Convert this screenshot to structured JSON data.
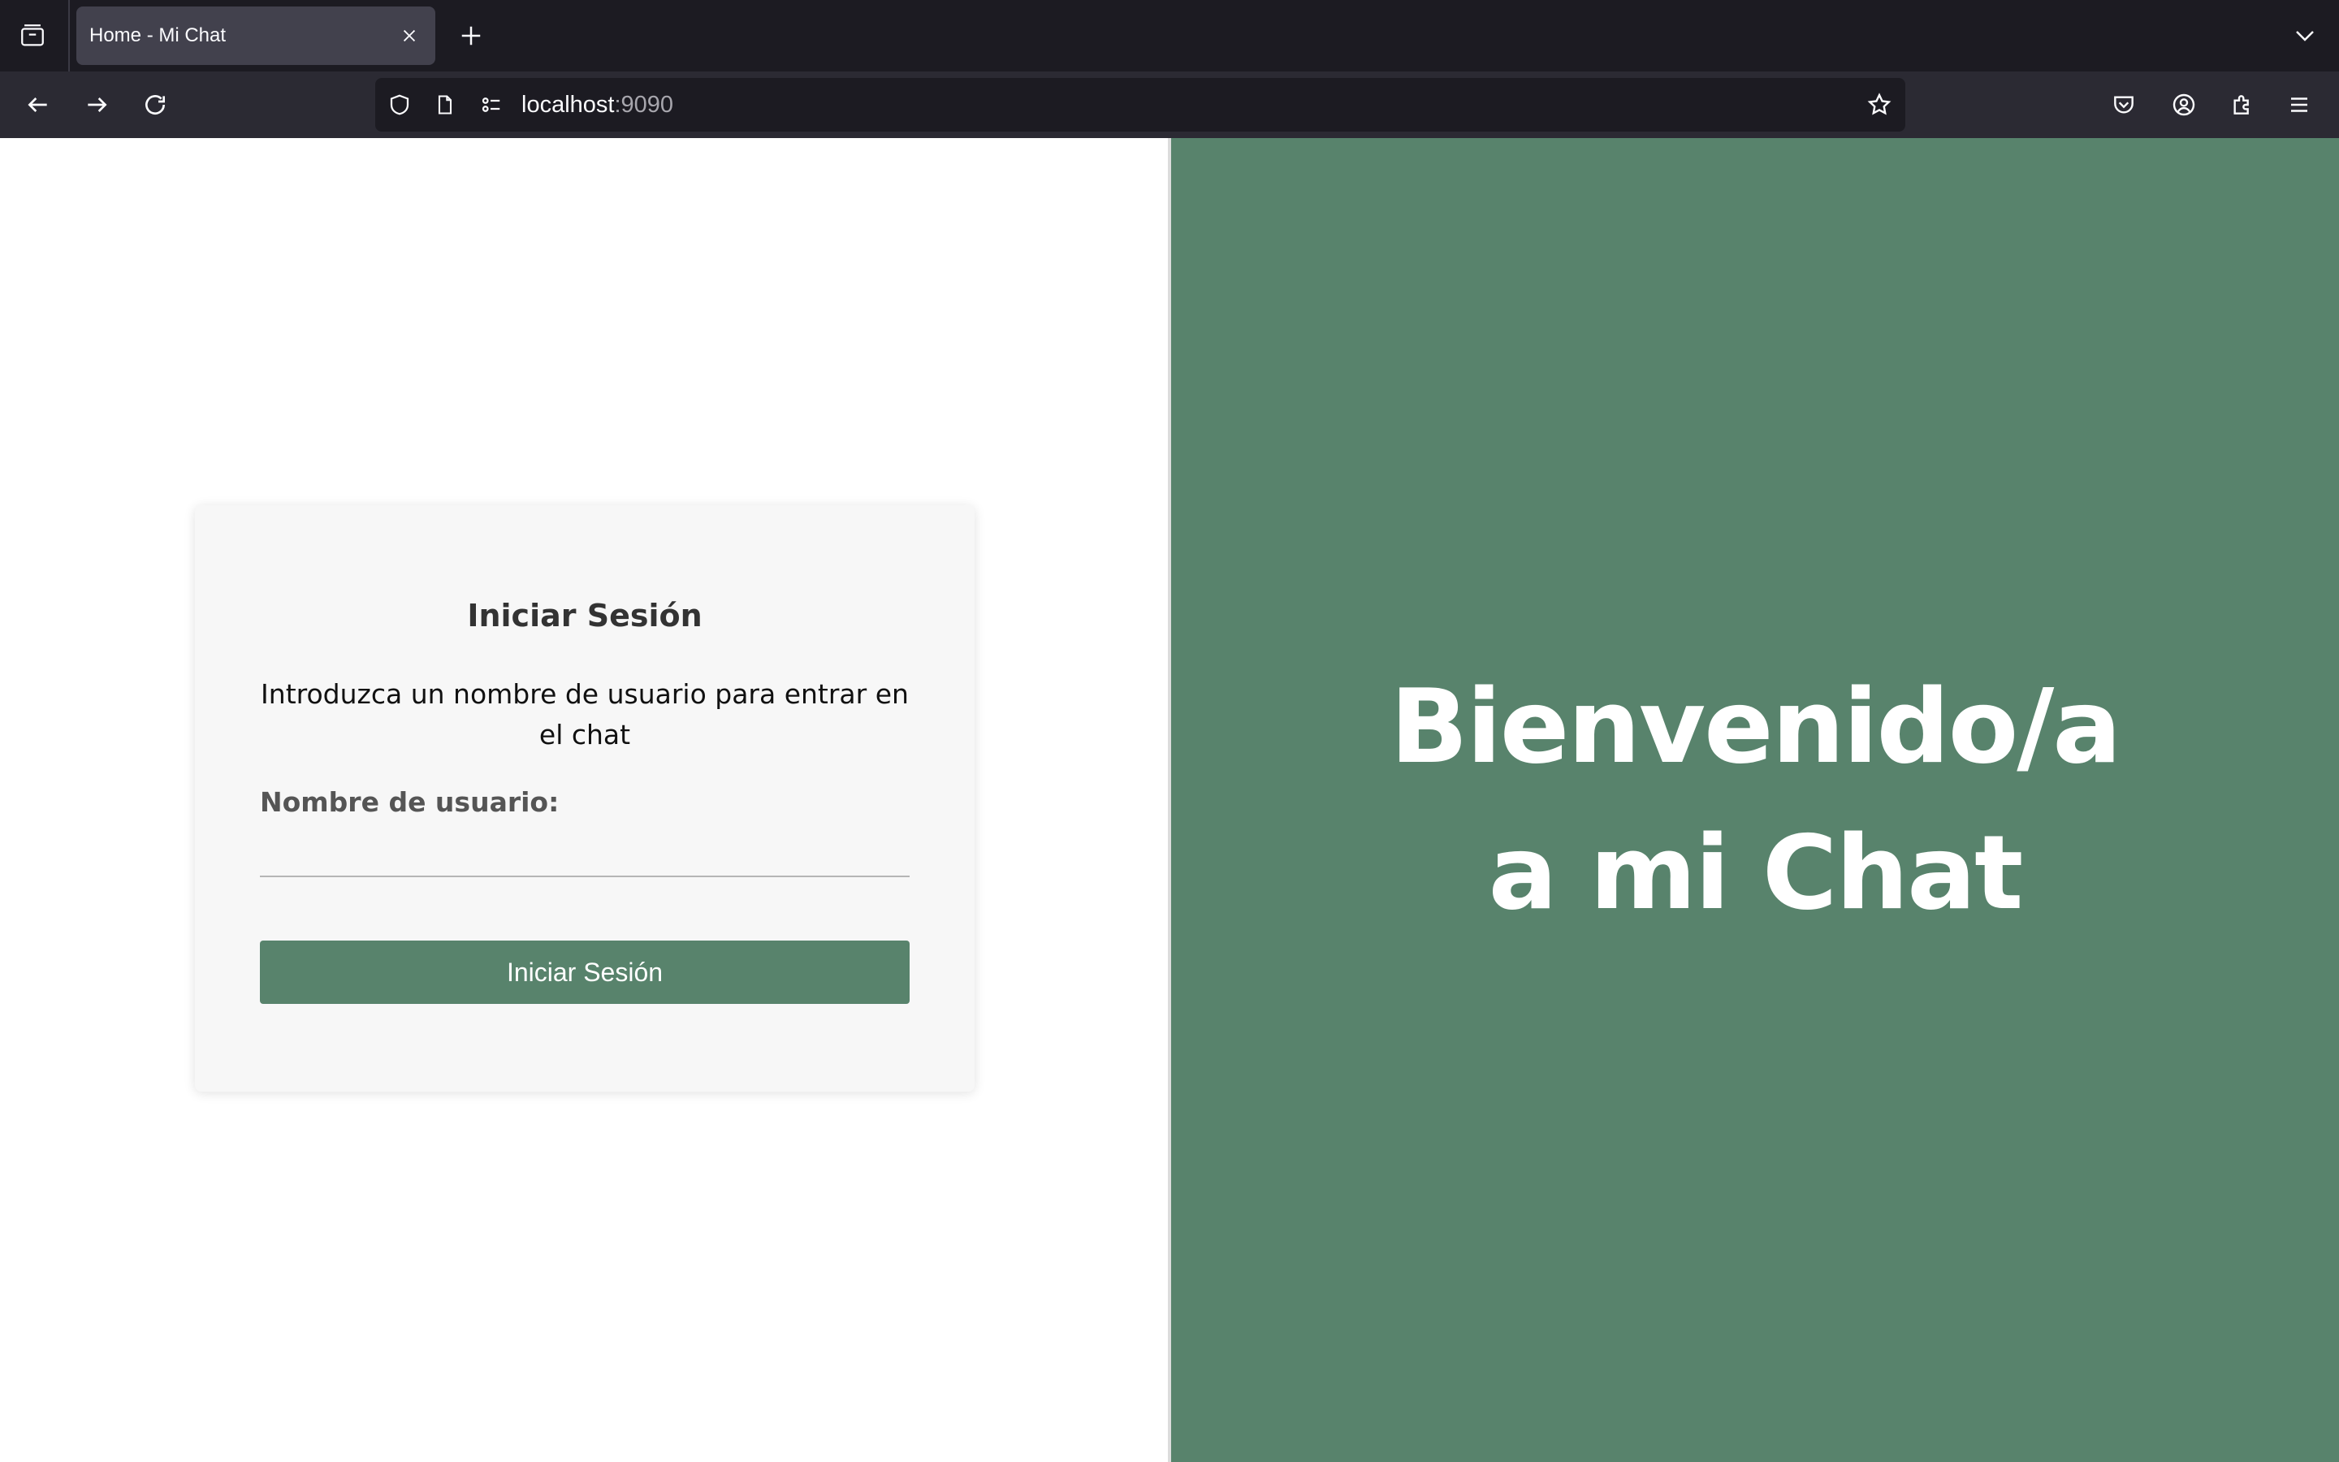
{
  "browser": {
    "tab": {
      "title": "Home - Mi Chat"
    },
    "url": {
      "host": "localhost",
      "port": ":9090"
    },
    "icons": {
      "tab_list": "tab-list-icon",
      "close": "close-icon",
      "new_tab": "plus-icon",
      "overflow": "chevron-down-icon",
      "back": "arrow-left-icon",
      "forward": "arrow-right-icon",
      "reload": "reload-icon",
      "shield": "shield-icon",
      "page": "page-icon",
      "permissions": "permissions-icon",
      "bookmark": "star-icon",
      "pocket": "pocket-icon",
      "account": "account-icon",
      "extensions": "puzzle-icon",
      "menu": "hamburger-icon"
    }
  },
  "login": {
    "title": "Iniciar Sesión",
    "description": "Introduzca un nombre de usuario para entrar en el chat",
    "username_label": "Nombre de usuario:",
    "username_value": "",
    "submit_label": "Iniciar Sesión"
  },
  "welcome": {
    "line1": "Bienvenido/a",
    "line2": "a mi Chat"
  },
  "colors": {
    "accent": "#58836c",
    "tabbar_bg": "#1c1b22",
    "navbar_bg": "#2b2a33",
    "card_bg": "#f7f7f7"
  }
}
